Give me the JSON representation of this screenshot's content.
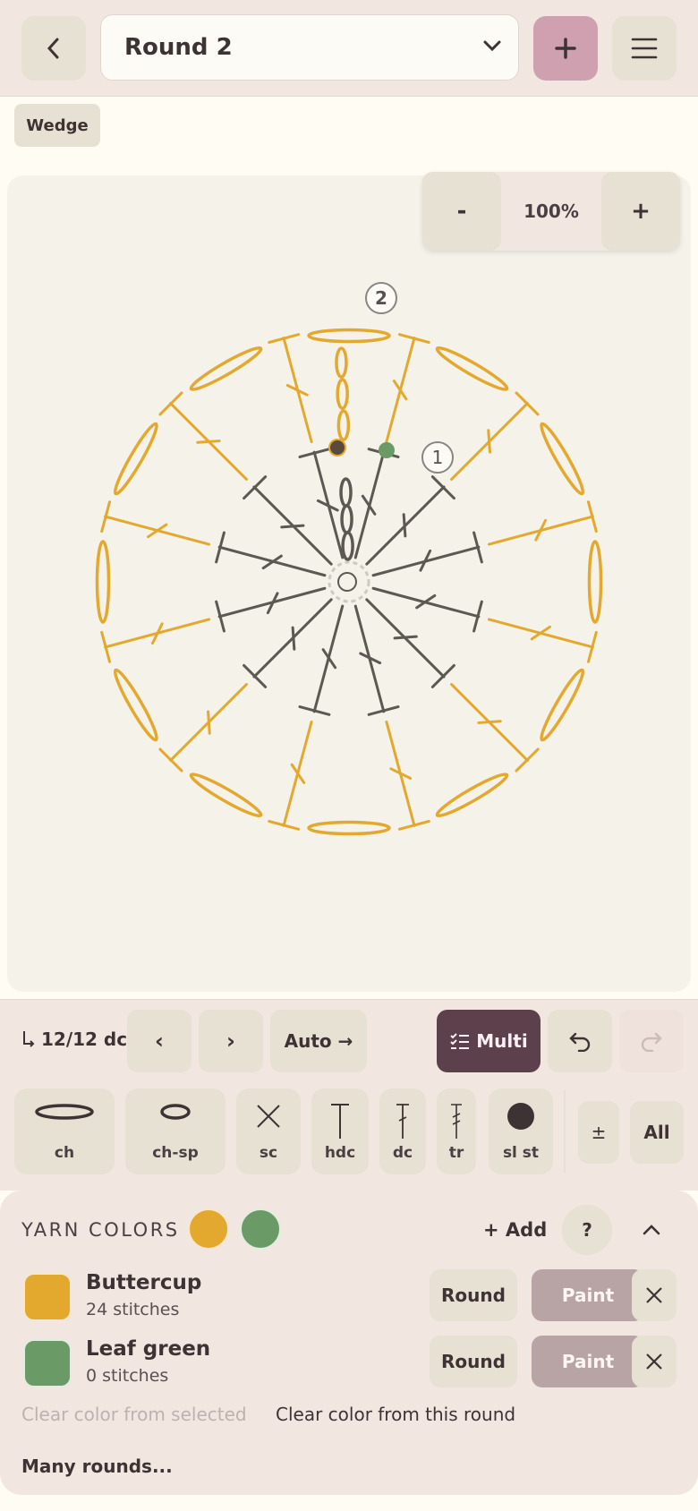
{
  "header": {
    "round_select": "Round 2"
  },
  "wedge_label": "Wedge",
  "zoom": {
    "minus": "-",
    "value": "100%",
    "plus": "+"
  },
  "chart": {
    "round_markers": [
      "2",
      "1"
    ]
  },
  "controls": {
    "progress": "12/12 dc",
    "prev": "‹",
    "next": "›",
    "auto": "Auto →",
    "multi": "Multi"
  },
  "stitches": [
    {
      "label": "ch"
    },
    {
      "label": "ch-sp"
    },
    {
      "label": "sc"
    },
    {
      "label": "hdc"
    },
    {
      "label": "dc"
    },
    {
      "label": "tr"
    },
    {
      "label": "sl st"
    }
  ],
  "stitch_extra": {
    "plusminus": "±",
    "all": "All"
  },
  "yarn": {
    "title": "YARN COLORS",
    "add": "+ Add",
    "help": "?",
    "colors": [
      {
        "name": "Buttercup",
        "count": "24 stitches",
        "hex": "#e3a92f",
        "round": "Round",
        "paint": "Paint"
      },
      {
        "name": "Leaf green",
        "count": "0 stitches",
        "hex": "#6a9a66",
        "round": "Round",
        "paint": "Paint"
      }
    ],
    "clear_selected": "Clear color from selected",
    "clear_round": "Clear color from this round",
    "many_rounds": "Many rounds..."
  },
  "palette": {
    "gold": "#e3a92f",
    "green": "#6a9a66",
    "dark": "#5e5853",
    "accent": "#cfa1b0",
    "multi_bg": "#5c404b"
  }
}
